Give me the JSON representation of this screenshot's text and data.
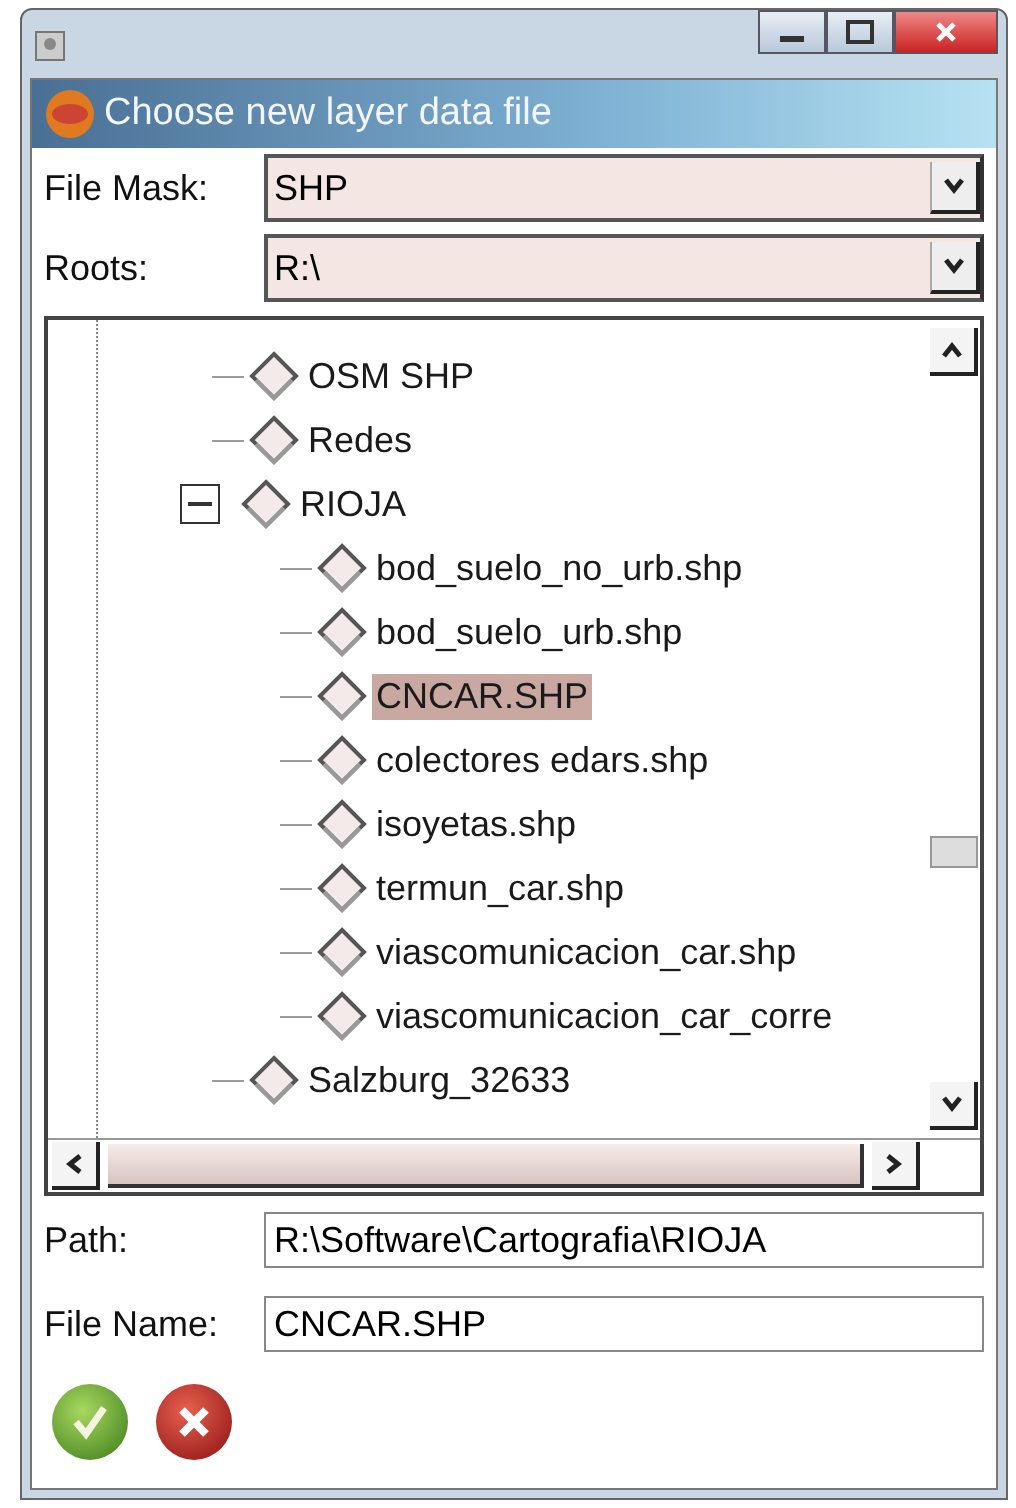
{
  "dialog": {
    "title": "Choose new layer data file"
  },
  "fields": [
    {
      "kind": "combo",
      "label": "File Mask:",
      "value": "SHP"
    },
    {
      "kind": "combo",
      "label": "Roots:",
      "value": "R:\\"
    }
  ],
  "tree": [
    {
      "label": "OSM SHP",
      "selected": false
    },
    {
      "label": "Redes",
      "selected": false
    },
    {
      "label": "RIOJA",
      "selected": false,
      "expanded": true,
      "children": [
        {
          "label": "bod_suelo_no_urb.shp",
          "selected": false
        },
        {
          "label": "bod_suelo_urb.shp",
          "selected": false
        },
        {
          "label": "CNCAR.SHP",
          "selected": true
        },
        {
          "label": "colectores edars.shp",
          "selected": false
        },
        {
          "label": "isoyetas.shp",
          "selected": false
        },
        {
          "label": "termun_car.shp",
          "selected": false
        },
        {
          "label": "viascomunicacion_car.shp",
          "selected": false
        },
        {
          "label": "viascomunicacion_car_corre",
          "selected": false
        }
      ]
    },
    {
      "label": "Salzburg_32633",
      "selected": false
    }
  ],
  "bottom_fields": [
    {
      "kind": "text",
      "label": "Path:",
      "value": "R:\\Software\\Cartografia\\RIOJA"
    },
    {
      "kind": "text",
      "label": "File Name:",
      "value": "CNCAR.SHP"
    }
  ]
}
